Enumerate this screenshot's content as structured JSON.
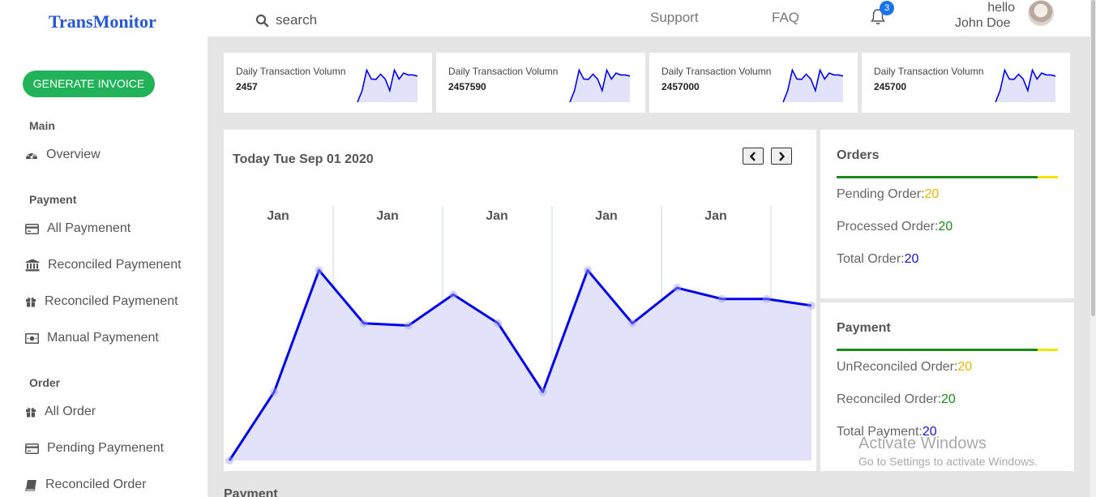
{
  "header": {
    "logo": "TransMonitor",
    "search_label": "search",
    "support": "Support",
    "faq": "FAQ",
    "notification_count": "3",
    "greeting": "hello",
    "user_name": "John Doe"
  },
  "sidebar": {
    "generate_button": "GENERATE INVOICE",
    "sections": [
      {
        "title": "Main",
        "items": [
          {
            "label": "Overview",
            "icon": "dashboard-icon"
          }
        ]
      },
      {
        "title": "Payment",
        "items": [
          {
            "label": "All Paymenent",
            "icon": "credit-card-icon"
          },
          {
            "label": "Reconciled Paymenent",
            "icon": "bank-icon"
          },
          {
            "label": "Reconciled Paymenent",
            "icon": "gift-icon"
          },
          {
            "label": "Manual Paymenent",
            "icon": "money-bill-icon"
          }
        ]
      },
      {
        "title": "Order",
        "items": [
          {
            "label": "All Order",
            "icon": "gift-icon"
          },
          {
            "label": "Pending Paymenent",
            "icon": "credit-card-icon"
          },
          {
            "label": "Reconciled Order",
            "icon": "book-icon"
          }
        ]
      }
    ]
  },
  "stats": [
    {
      "title": "Daily Transaction Volumn",
      "value": "2457"
    },
    {
      "title": "Daily Transaction Volumn",
      "value": "2457590"
    },
    {
      "title": "Daily Transaction Volumn",
      "value": "2457000"
    },
    {
      "title": "Daily Transaction Volumn",
      "value": "245700"
    }
  ],
  "chart_panel": {
    "title": "Today Tue Sep 01 2020",
    "column_labels": [
      "Jan",
      "Jan",
      "Jan",
      "Jan",
      "Jan"
    ]
  },
  "chart_data": {
    "type": "area",
    "title": "",
    "xlabel": "",
    "ylabel": "",
    "categories": [
      "Jan",
      "Jan",
      "Jan",
      "Jan",
      "Jan"
    ],
    "values": [
      0,
      31,
      86,
      62,
      61,
      75,
      62,
      31,
      86,
      62,
      78,
      73,
      73,
      70
    ],
    "ylim": [
      0,
      100
    ],
    "grid": true,
    "line_color": "#0000ee",
    "fill_color": "#e2e2fb"
  },
  "orders": {
    "title": "Orders",
    "rows": [
      {
        "label": "Pending Order:",
        "value": "20",
        "color": "#e8b800"
      },
      {
        "label": "Processed Order:",
        "value": "20",
        "color": "#1a8a1a"
      },
      {
        "label": "Total Order:",
        "value": "20",
        "color": "#1515d0"
      }
    ]
  },
  "payment": {
    "title": "Payment",
    "rows": [
      {
        "label": "UnReconciled Order:",
        "value": "20",
        "color": "#e8b800"
      },
      {
        "label": "Reconciled Order:",
        "value": "20",
        "color": "#1a8a1a"
      },
      {
        "label": "Total Payment:",
        "value": "20",
        "color": "#1515d0"
      }
    ]
  },
  "bottom_section_title": "Payment",
  "watermark": {
    "title": "Activate Windows",
    "subtitle": "Go to Settings to activate Windows."
  },
  "colors": {
    "accent_green": "#22b35a",
    "brand_blue": "#2557d6",
    "badge_blue": "#1a73e8"
  }
}
